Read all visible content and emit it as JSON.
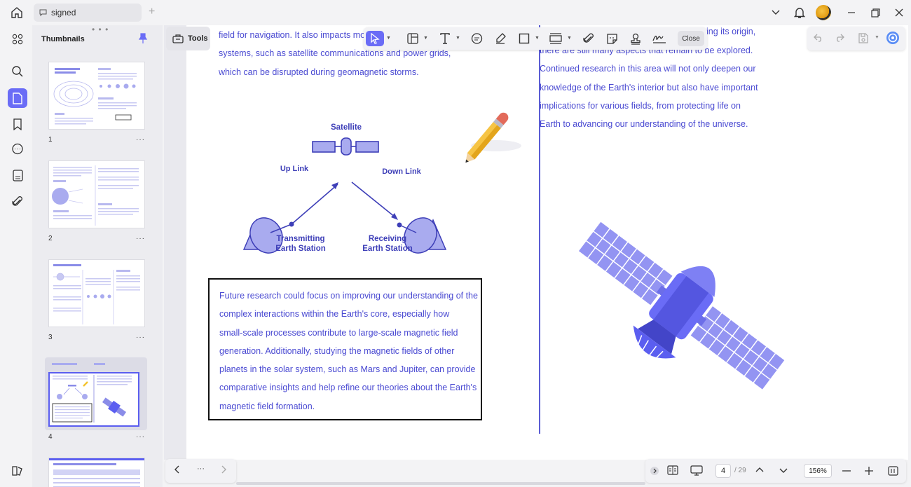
{
  "tab": {
    "title": "signed"
  },
  "sidebar": {
    "panel_title": "Thumbnails"
  },
  "thumbnails": [
    {
      "number": "1",
      "more": "···"
    },
    {
      "number": "2",
      "more": "···"
    },
    {
      "number": "3",
      "more": "···"
    },
    {
      "number": "4",
      "more": "···"
    }
  ],
  "toolbar": {
    "tools_label": "Tools",
    "close_label": "Close"
  },
  "document": {
    "left_top_lines": [
      "field for navigation. It also impacts mo",
      "systems, such as satellite communications and power grids,",
      "which can be disrupted during geomagnetic storms."
    ],
    "right_top_lines": [
      "ing its origin,",
      "there are still many aspects that remain to be explored.",
      "Continued research in this area will not only deepen our",
      "knowledge of the Earth's interior but also have important",
      "implications for various fields, from protecting life on",
      "Earth to advancing our understanding of the universe."
    ],
    "diagram": {
      "satellite": "Satellite",
      "uplink": "Up Link",
      "downlink": "Down Link",
      "tx_line1": "Transmitting",
      "tx_line2": "Earth Station",
      "rx_line1": "Receiving",
      "rx_line2": "Earth Station"
    },
    "textbox_lines": [
      "Future research could focus on improving our understanding of the",
      "complex interactions within the Earth's core, especially how",
      "small-scale processes contribute to large-scale magnetic field",
      "generation. Additionally, studying the magnetic fields of other",
      "planets in the solar system, such as Mars and Jupiter, can provide",
      "comparative insights and help refine our theories about the Earth's",
      "magnetic field formation."
    ]
  },
  "pager": {
    "more": "···",
    "current_page": "4",
    "total_pages": "/ 29",
    "zoom": "156%"
  },
  "colors": {
    "accent": "#6a6cf6",
    "text_blue": "#4a4ad2"
  }
}
